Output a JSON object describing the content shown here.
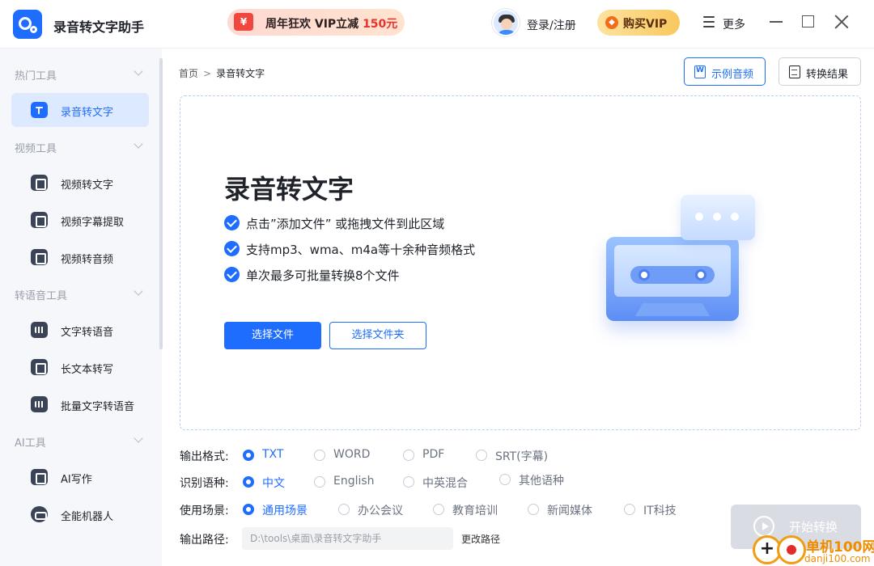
{
  "app": {
    "title": "录音转文字助手"
  },
  "header": {
    "promo_prefix": "周年狂欢 VIP立减",
    "promo_amount": "150元",
    "login": "登录/注册",
    "buy_vip": "购买VIP",
    "more": "更多"
  },
  "sidebar": {
    "groups": [
      {
        "title": "热门工具",
        "items": [
          {
            "label": "录音转文字",
            "icon": "t-icon",
            "active": true
          }
        ]
      },
      {
        "title": "视频工具",
        "items": [
          {
            "label": "视频转文字",
            "icon": "video-text-icon"
          },
          {
            "label": "视频字幕提取",
            "icon": "subtitle-icon"
          },
          {
            "label": "视频转音频",
            "icon": "video-audio-icon"
          }
        ]
      },
      {
        "title": "转语音工具",
        "items": [
          {
            "label": "文字转语音",
            "icon": "waveform-icon"
          },
          {
            "label": "长文本转写",
            "icon": "long-text-icon"
          },
          {
            "label": "批量文字转语音",
            "icon": "batch-waveform-icon"
          }
        ]
      },
      {
        "title": "AI工具",
        "items": [
          {
            "label": "AI写作",
            "icon": "ai-writing-icon"
          },
          {
            "label": "全能机器人",
            "icon": "robot-icon"
          }
        ]
      }
    ]
  },
  "breadcrumb": {
    "home": "首页",
    "separator": ">",
    "current": "录音转文字"
  },
  "toolbar": {
    "sample_audio": "示例音频",
    "convert_result": "转换结果"
  },
  "dropzone": {
    "title": "录音转文字",
    "features": [
      "点击”添加文件” 或拖拽文件到此区域",
      "支持mp3、wma、m4a等十余种音频格式",
      "单次最多可批量转换8个文件"
    ],
    "select_file": "选择文件",
    "select_folder": "选择文件夹"
  },
  "options": {
    "format": {
      "label": "输出格式:",
      "choices": [
        "TXT",
        "WORD",
        "PDF",
        "SRT(字幕)"
      ],
      "selected": "TXT"
    },
    "language": {
      "label": "识别语种:",
      "choices": [
        "中文",
        "English",
        "中英混合",
        "其他语种"
      ],
      "selected": "中文"
    },
    "scene": {
      "label": "使用场景:",
      "choices": [
        "通用场景",
        "办公会议",
        "教育培训",
        "新闻媒体",
        "IT科技"
      ],
      "selected": "通用场景"
    },
    "output_path": {
      "label": "输出路径:",
      "value": "D:\\tools\\桌面\\录音转文字助手",
      "change": "更改路径"
    }
  },
  "start_button": "开始转换",
  "watermark": {
    "line1": "单机100网",
    "line2": "danji100.com"
  },
  "colors": {
    "accent": "#1e6dff",
    "sidebar_bg": "#f5f7fb",
    "active_bg": "#dde9ff",
    "promo_red": "#e8322c"
  }
}
